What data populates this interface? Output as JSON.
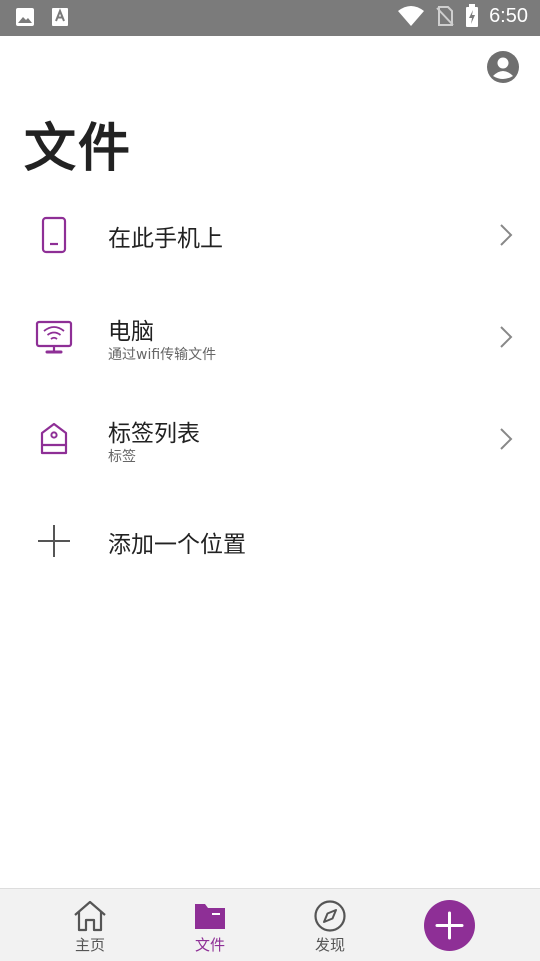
{
  "status_bar": {
    "time": "6:50"
  },
  "page": {
    "title": "文件"
  },
  "locations": [
    {
      "title": "在此手机上",
      "subtitle": ""
    },
    {
      "title": "电脑",
      "subtitle": "通过wifi传输文件"
    },
    {
      "title": "标签列表",
      "subtitle": "标签"
    },
    {
      "title": "添加一个位置",
      "subtitle": ""
    }
  ],
  "bottom_nav": {
    "tabs": [
      {
        "label": "主页",
        "icon": "home-icon"
      },
      {
        "label": "文件",
        "icon": "folder-icon",
        "active": true
      },
      {
        "label": "发现",
        "icon": "compass-icon"
      }
    ],
    "fab_icon": "plus-icon"
  },
  "colors": {
    "accent": "#8e2f96",
    "status_bar": "#7b7b7b",
    "nav_bg": "#f2f2f2"
  }
}
